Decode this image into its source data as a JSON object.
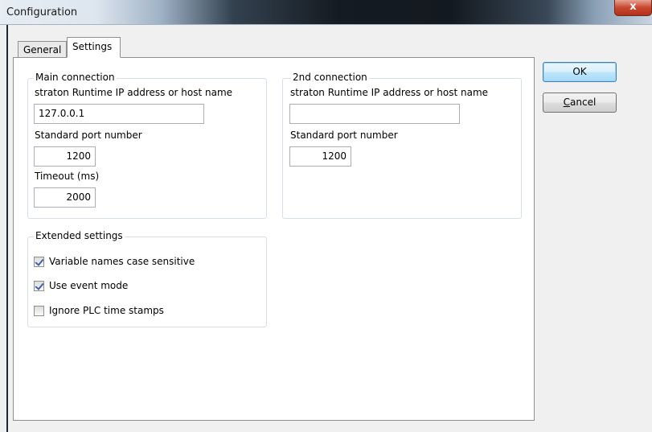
{
  "window": {
    "title": "Configuration",
    "close_label": "x"
  },
  "tabs": {
    "general": "General",
    "settings": "Settings"
  },
  "main_connection": {
    "legend": "Main connection",
    "ip_label": "straton Runtime IP address or host name",
    "ip_value": "127.0.0.1",
    "port_label": "Standard port number",
    "port_value": "1200",
    "timeout_label": "Timeout (ms)",
    "timeout_value": "2000"
  },
  "second_connection": {
    "legend": "2nd connection",
    "ip_label": "straton Runtime IP address or host name",
    "ip_value": "",
    "port_label": "Standard port number",
    "port_value": "1200"
  },
  "extended_settings": {
    "legend": "Extended settings",
    "options": [
      {
        "label": "Variable names case sensitive",
        "checked": true
      },
      {
        "label": "Use event mode",
        "checked": true
      },
      {
        "label": "Ignore PLC time stamps",
        "checked": false
      }
    ]
  },
  "buttons": {
    "ok": "OK",
    "cancel_prefix": "C",
    "cancel_rest": "ancel"
  }
}
